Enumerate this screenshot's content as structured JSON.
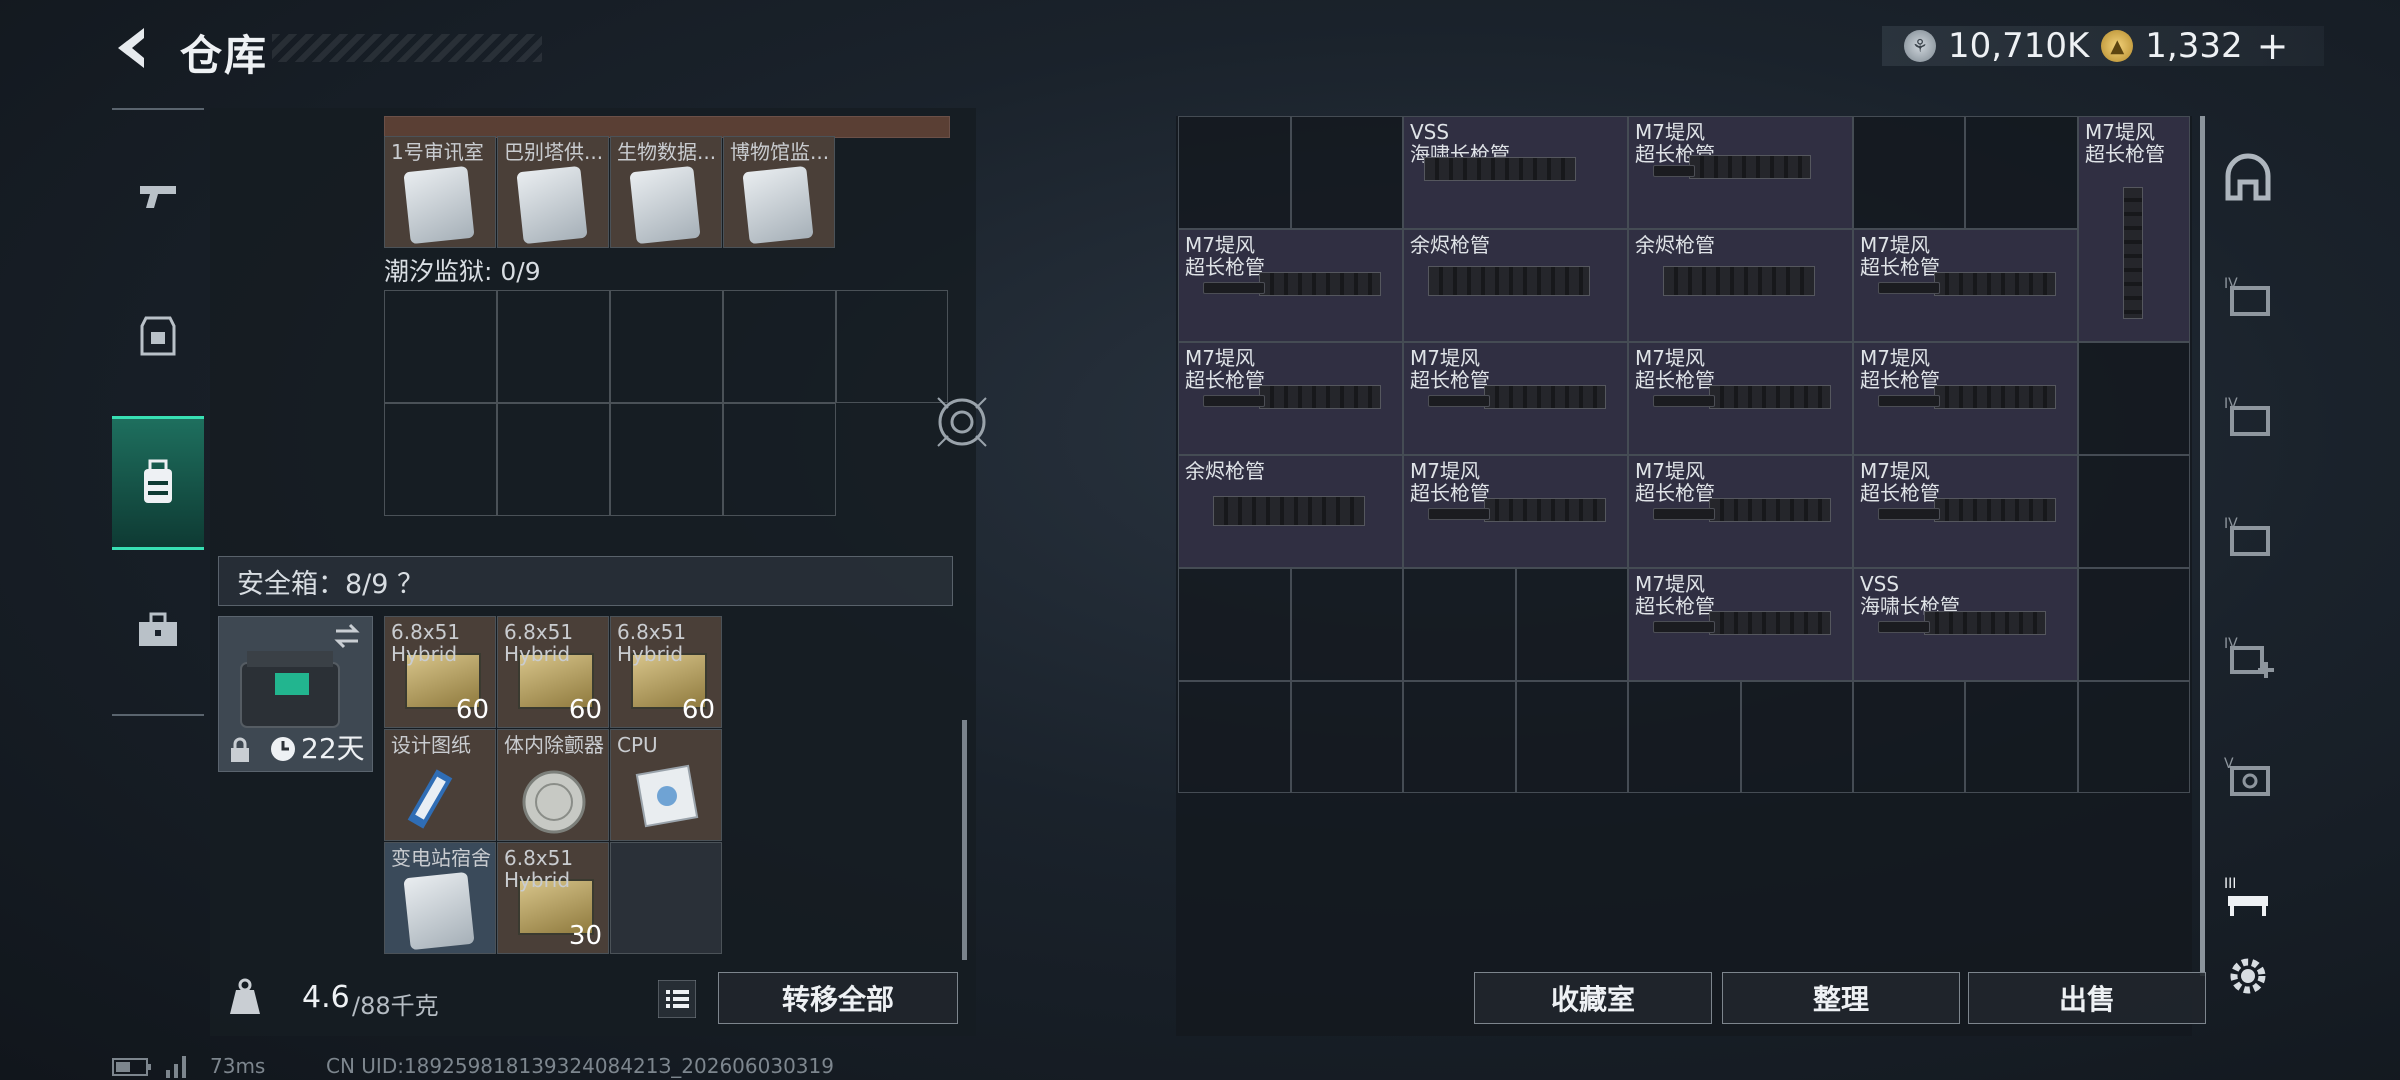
{
  "header": {
    "title": "仓库"
  },
  "currency": {
    "silver": "10,710K",
    "gold": "1,332",
    "add": "+"
  },
  "left": {
    "top_items": [
      {
        "label": "1号审讯室"
      },
      {
        "label": "巴别塔供..."
      },
      {
        "label": "生物数据..."
      },
      {
        "label": "博物馆监..."
      }
    ],
    "prison_label": "潮汐监狱: 0/9",
    "safe_label": "安全箱：8/9 ？",
    "safe_time": "22天",
    "safe_items": [
      {
        "label": "6.8x51\nHybrid",
        "qty": "60",
        "kind": "ammo"
      },
      {
        "label": "6.8x51\nHybrid",
        "qty": "60",
        "kind": "ammo"
      },
      {
        "label": "6.8x51\nHybrid",
        "qty": "60",
        "kind": "ammo"
      },
      {
        "label": "设计图纸",
        "qty": "",
        "kind": "blueprint"
      },
      {
        "label": "体内除颤器",
        "qty": "",
        "kind": "defib"
      },
      {
        "label": "CPU",
        "qty": "",
        "kind": "cpu"
      },
      {
        "label": "变电站宿舍",
        "qty": "",
        "kind": "card"
      },
      {
        "label": "6.8x51\nHybrid",
        "qty": "30",
        "kind": "ammo"
      }
    ],
    "weight_value": "4.6",
    "weight_max": "/88千克",
    "transfer_all": "转移全部"
  },
  "right": {
    "weapons": [
      {
        "label": "VSS\n海啸长枪管"
      },
      {
        "label": "M7堤风\n超长枪管"
      },
      {
        "label": "M7堤风\n超长枪管"
      },
      {
        "label": "M7堤风\n超长枪管"
      },
      {
        "label": "余烬枪管"
      },
      {
        "label": "余烬枪管"
      },
      {
        "label": "M7堤风\n超长枪管"
      },
      {
        "label": "M7堤风\n超长枪管"
      },
      {
        "label": "M7堤风\n超长枪管"
      },
      {
        "label": "M7堤风\n超长枪管"
      },
      {
        "label": "M7堤风\n超长枪管"
      },
      {
        "label": "余烬枪管"
      },
      {
        "label": "M7堤风\n超长枪管"
      },
      {
        "label": "M7堤风\n超长枪管"
      },
      {
        "label": "M7堤风\n超长枪管"
      },
      {
        "label": "M7堤风\n超长枪管"
      },
      {
        "label": "VSS\n海啸长枪管"
      }
    ],
    "buttons": {
      "collection": "收藏室",
      "sort": "整理",
      "sell": "出售"
    }
  },
  "footer": {
    "ping": "73ms",
    "uid": "CN UID:18925981813932408421З_202606030319"
  }
}
